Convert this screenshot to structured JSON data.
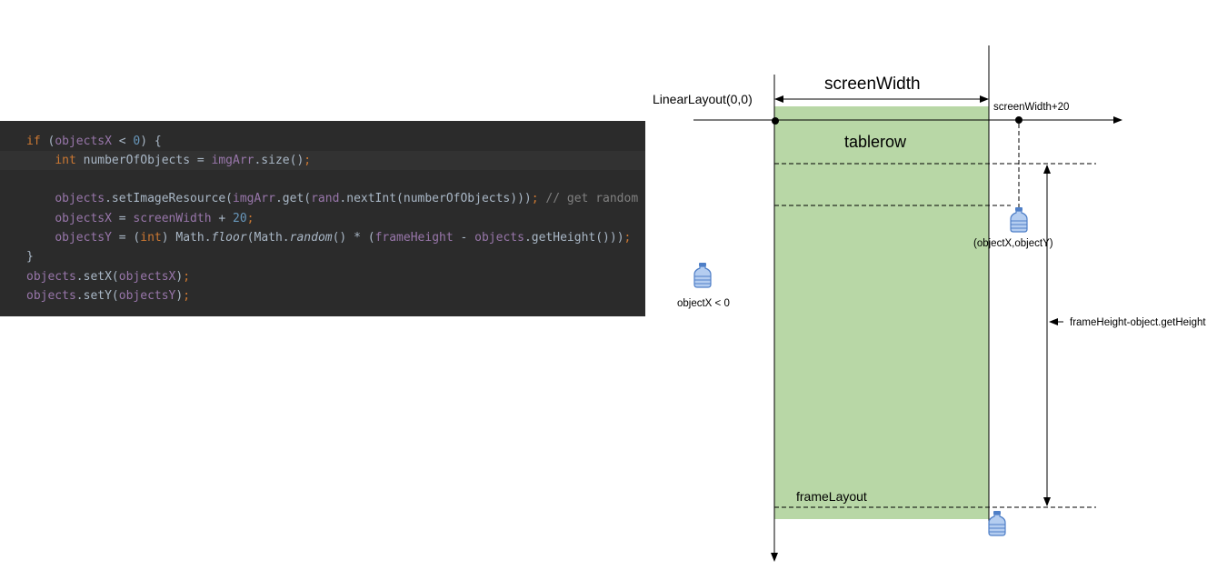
{
  "code": {
    "lines": [
      [
        {
          "t": "if",
          "c": "keyword"
        },
        {
          "t": " (",
          "c": "plain"
        },
        {
          "t": "objectsX",
          "c": "field"
        },
        {
          "t": " < ",
          "c": "plain"
        },
        {
          "t": "0",
          "c": "number"
        },
        {
          "t": ") {",
          "c": "plain"
        }
      ],
      [
        {
          "t": "    ",
          "c": "plain"
        },
        {
          "t": "int",
          "c": "keyword"
        },
        {
          "t": " numberOfObjects = ",
          "c": "plain"
        },
        {
          "t": "imgArr",
          "c": "field"
        },
        {
          "t": ".size()",
          "c": "plain"
        },
        {
          "t": ";",
          "c": "keyword"
        }
      ],
      [],
      [
        {
          "t": "    ",
          "c": "plain"
        },
        {
          "t": "objects",
          "c": "field"
        },
        {
          "t": ".setImageResource(",
          "c": "plain"
        },
        {
          "t": "imgArr",
          "c": "field"
        },
        {
          "t": ".get(",
          "c": "plain"
        },
        {
          "t": "rand",
          "c": "field"
        },
        {
          "t": ".nextInt(numberOfObjects)))",
          "c": "plain"
        },
        {
          "t": ";",
          "c": "keyword"
        },
        {
          "t": " // get random",
          "c": "comment"
        }
      ],
      [
        {
          "t": "    ",
          "c": "plain"
        },
        {
          "t": "objectsX",
          "c": "field"
        },
        {
          "t": " = ",
          "c": "plain"
        },
        {
          "t": "screenWidth",
          "c": "field"
        },
        {
          "t": " + ",
          "c": "plain"
        },
        {
          "t": "20",
          "c": "number"
        },
        {
          "t": ";",
          "c": "keyword"
        }
      ],
      [
        {
          "t": "    ",
          "c": "plain"
        },
        {
          "t": "objectsY",
          "c": "field"
        },
        {
          "t": " = (",
          "c": "plain"
        },
        {
          "t": "int",
          "c": "keyword"
        },
        {
          "t": ") Math.",
          "c": "plain"
        },
        {
          "t": "floor",
          "c": "italic"
        },
        {
          "t": "(Math.",
          "c": "plain"
        },
        {
          "t": "random",
          "c": "italic"
        },
        {
          "t": "() * (",
          "c": "plain"
        },
        {
          "t": "frameHeight",
          "c": "field"
        },
        {
          "t": " - ",
          "c": "plain"
        },
        {
          "t": "objects",
          "c": "field"
        },
        {
          "t": ".getHeight()))",
          "c": "plain"
        },
        {
          "t": ";",
          "c": "keyword"
        }
      ],
      [
        {
          "t": "}",
          "c": "plain"
        }
      ],
      [
        {
          "t": "objects",
          "c": "field"
        },
        {
          "t": ".setX(",
          "c": "plain"
        },
        {
          "t": "objectsX",
          "c": "field"
        },
        {
          "t": ")",
          "c": "plain"
        },
        {
          "t": ";",
          "c": "keyword"
        }
      ],
      [
        {
          "t": "objects",
          "c": "field"
        },
        {
          "t": ".setY(",
          "c": "plain"
        },
        {
          "t": "objectsY",
          "c": "field"
        },
        {
          "t": ")",
          "c": "plain"
        },
        {
          "t": ";",
          "c": "keyword"
        }
      ]
    ],
    "current_line": 1
  },
  "diagram": {
    "labels": {
      "origin": "LinearLayout(0,0)",
      "screen_width": "screenWidth",
      "screen_width_plus": "screenWidth+20",
      "tablerow": "tablerow",
      "object_xy": "(objectX,objectY)",
      "object_x_neg": "objectX < 0",
      "frame_height": "frameHeight-object.getHeight",
      "frame_layout": "frameLayout"
    },
    "colors": {
      "layout_fill": "#b8d7a6",
      "bottle_fill": "#b4cdf0",
      "bottle_stroke": "#4f7fc7",
      "line": "#000000"
    },
    "icons": [
      "water-bottle-icon",
      "water-bottle-icon",
      "water-bottle-icon"
    ]
  }
}
